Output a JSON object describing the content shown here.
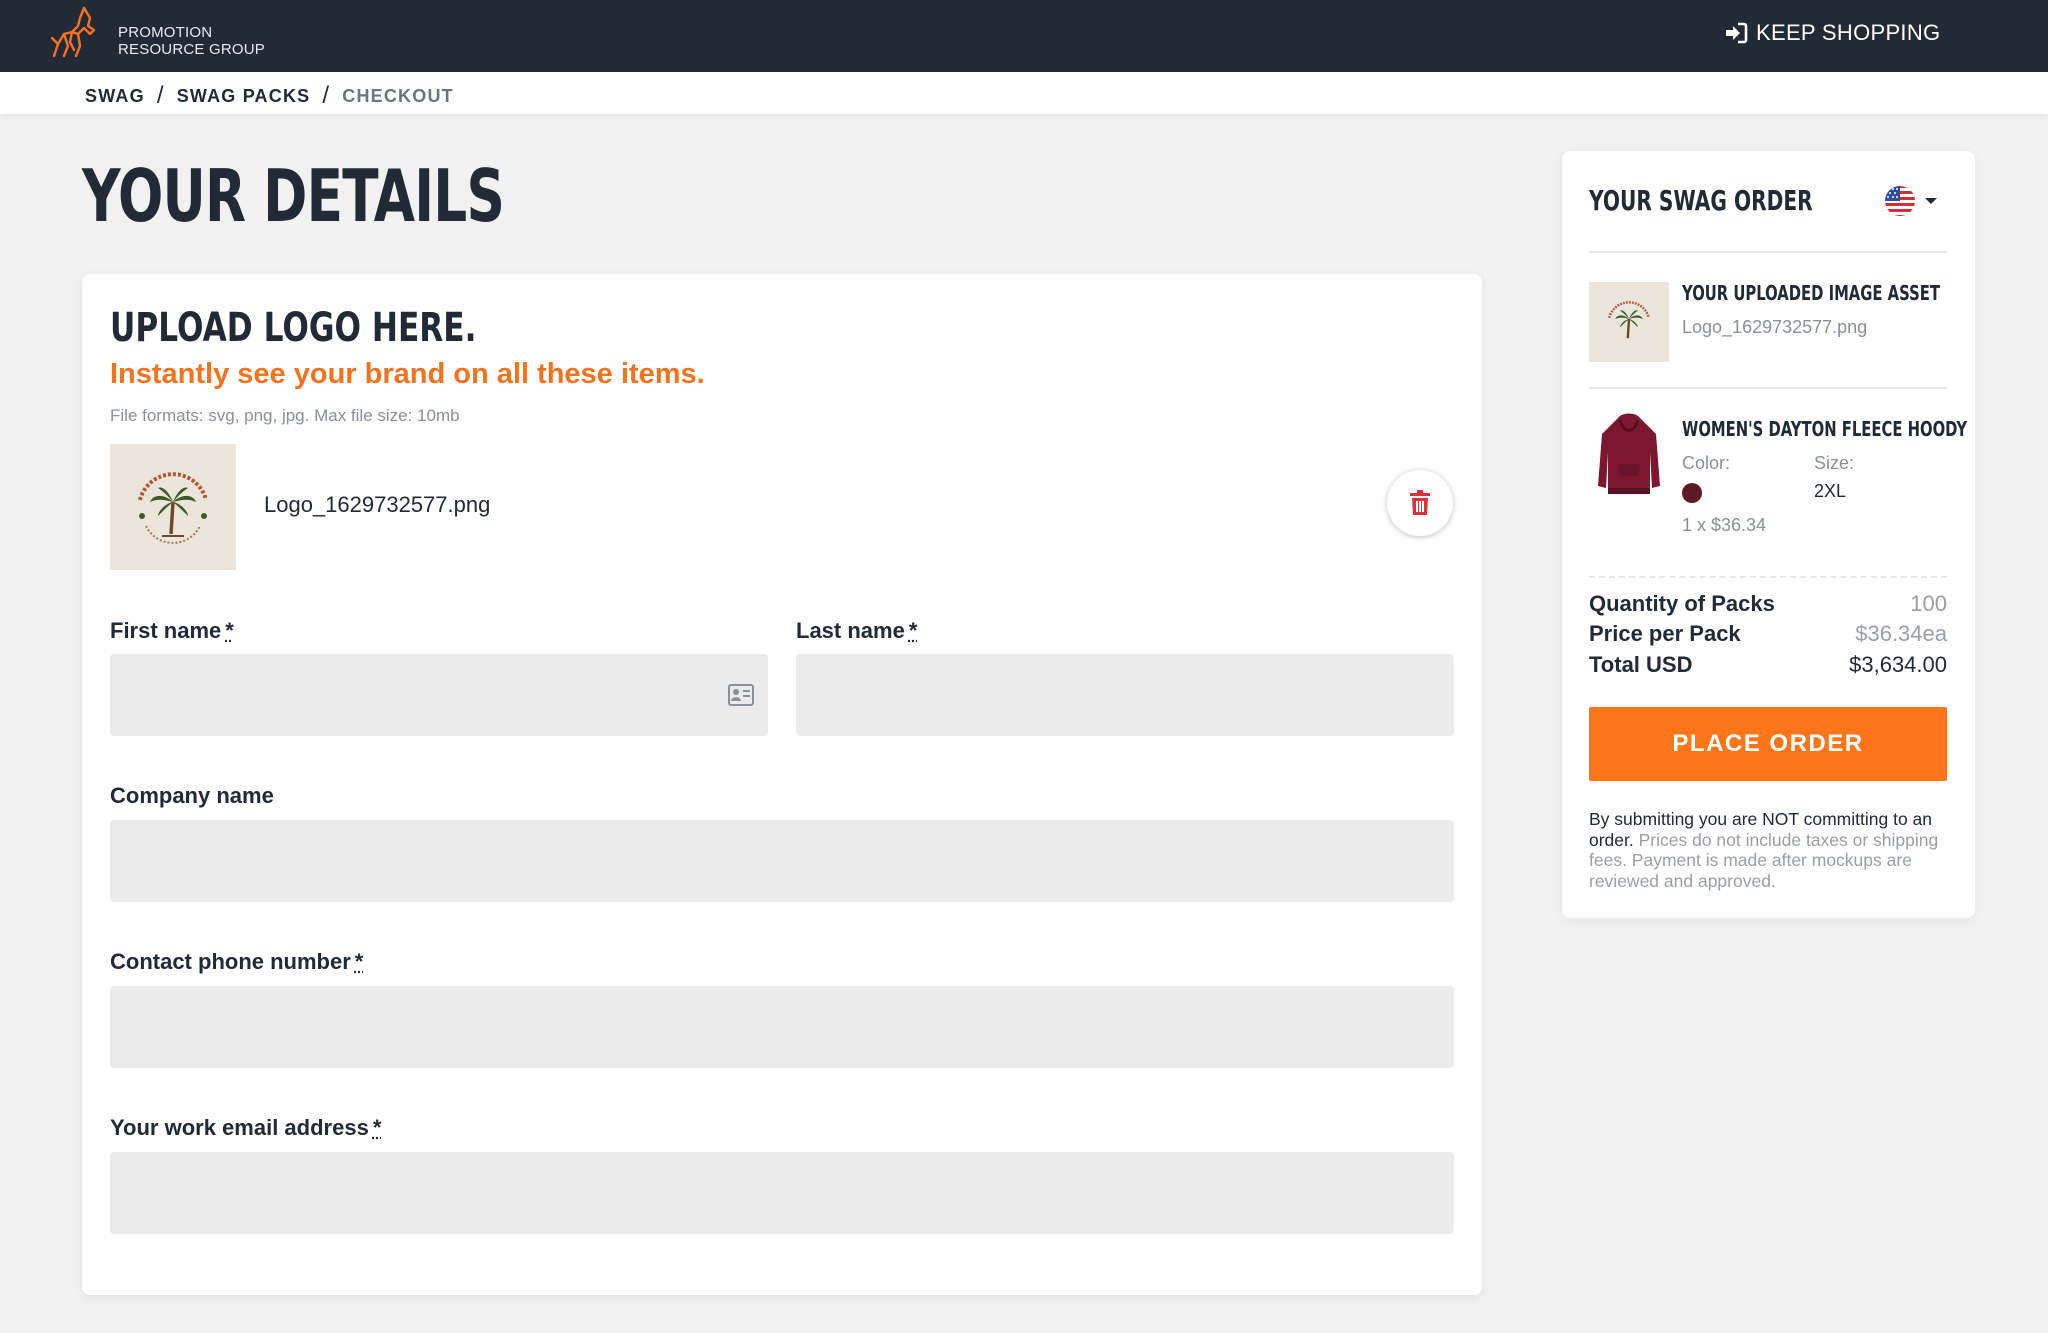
{
  "brand": {
    "line1": "PROMOTION",
    "line2": "RESOURCE GROUP",
    "accent_color": "#f5731f",
    "nav_color": "#222a35"
  },
  "header": {
    "keep_shopping_label": "KEEP SHOPPING",
    "keep_shopping_icon": "sign-in-icon"
  },
  "breadcrumb": {
    "items": [
      "SWAG",
      "SWAG PACKS",
      "CHECKOUT"
    ],
    "separator": "/"
  },
  "page_title": "YOUR DETAILS",
  "upload": {
    "title": "UPLOAD LOGO HERE.",
    "subtitle": "Instantly see your brand on all these items.",
    "formats": "File formats: svg, png, jpg. Max file size: 10mb",
    "file_name": "Logo_1629732577.png",
    "delete_icon": "trash-icon"
  },
  "form": {
    "required_marker": "*",
    "first_name_label": "First name",
    "last_name_label": "Last name",
    "company_label": "Company name",
    "phone_label": "Contact phone number",
    "email_label": "Your work email address",
    "first_name_value": "",
    "last_name_value": "",
    "company_value": "",
    "phone_value": "",
    "email_value": ""
  },
  "order": {
    "title": "YOUR SWAG ORDER",
    "currency_flag": "us-flag-icon",
    "asset": {
      "title": "YOUR UPLOADED IMAGE ASSET",
      "file_name": "Logo_1629732577.png"
    },
    "product": {
      "title": "WOMEN'S DAYTON FLEECE HOODY",
      "color_label": "Color:",
      "color_hex": "#5b1a25",
      "size_label": "Size:",
      "size_value": "2XL",
      "qty_price": "1 x $36.34"
    },
    "summary": {
      "quantity_label": "Quantity of Packs",
      "quantity_value": "100",
      "price_label": "Price per Pack",
      "price_value": "$36.34ea",
      "total_label": "Total USD",
      "total_value": "$3,634.00"
    },
    "place_order_label": "PLACE ORDER",
    "disclaimer_strong": "By submitting you are NOT committing to an order.",
    "disclaimer_rest": "Prices do not include taxes or shipping fees. Payment is made after mockups are reviewed and approved."
  }
}
